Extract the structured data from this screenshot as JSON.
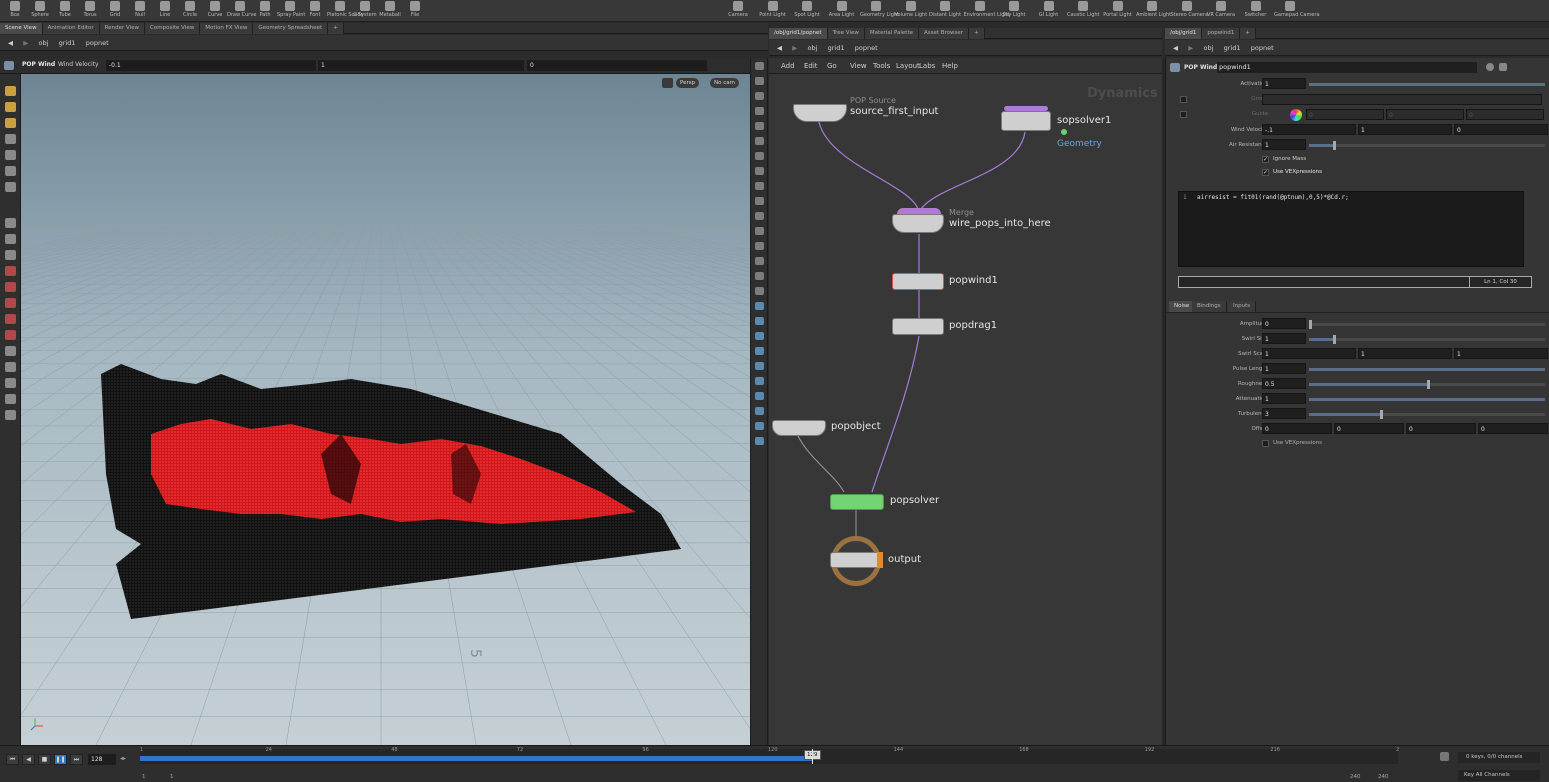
{
  "shelf": {
    "left_tools": [
      "Box",
      "Sphere",
      "Tube",
      "Torus",
      "Grid",
      "Null",
      "Line",
      "Circle",
      "Curve",
      "Draw Curve",
      "Path",
      "Spray Paint",
      "Font",
      "Platonic Solids",
      "L-System",
      "Metaball",
      "File"
    ],
    "right_tools": [
      "Camera",
      "Point Light",
      "Spot Light",
      "Area Light",
      "Geometry Light",
      "Volume Light",
      "Distant Light",
      "Environment Light",
      "Sky Light",
      "GI Light",
      "Caustic Light",
      "Portal Light",
      "Ambient Light",
      "Stereo Camera",
      "VR Camera",
      "Switcher",
      "Gamepad Camera"
    ]
  },
  "left_pane": {
    "tabs": [
      "Scene View",
      "Animation Editor",
      "Render View",
      "Composite View",
      "Motion FX View",
      "Geometry Spreadsheet"
    ],
    "path": [
      "obj",
      "grid1",
      "popnet"
    ],
    "op_bar": {
      "node_type": "POP Wind",
      "param_label": "Wind Velocity",
      "values": [
        "-0.1",
        "1",
        "0"
      ]
    },
    "viewport": {
      "camera_mode": "Persp",
      "camera": "No cam",
      "grid_number": "5"
    }
  },
  "network_pane": {
    "tabs": [
      "/obj/grid1/popnet",
      "Tree View",
      "Material Palette",
      "Asset Browser"
    ],
    "path": [
      "obj",
      "grid1",
      "popnet"
    ],
    "menu": [
      "Add",
      "Edit",
      "Go",
      "View",
      "Tools",
      "Layout",
      "Labs",
      "Help"
    ],
    "context_label": "Dynamics",
    "nodes": {
      "source": {
        "type": "POP Source",
        "name": "source_first_input"
      },
      "sopsolver": {
        "name": "sopsolver1",
        "sub": "Geometry"
      },
      "merge": {
        "type": "Merge",
        "name": "wire_pops_into_here"
      },
      "popwind": {
        "name": "popwind1"
      },
      "popdrag": {
        "name": "popdrag1"
      },
      "popobject": {
        "name": "popobject"
      },
      "popsolver": {
        "name": "popsolver"
      },
      "output": {
        "name": "output"
      }
    }
  },
  "param_pane": {
    "tabs": [
      "/obj/grid1",
      "popwind1"
    ],
    "path": [
      "obj",
      "grid1",
      "popnet"
    ],
    "header": {
      "node_type": "POP Wind",
      "node_name": "popwind1"
    },
    "rows": {
      "activation": {
        "label": "Activation",
        "value": "1"
      },
      "group": {
        "label": "Group"
      },
      "guide": {
        "label": "Guide",
        "values": [
          "0",
          "0",
          "0"
        ]
      },
      "wind_velocity": {
        "label": "Wind Velocity",
        "values": [
          "-.1",
          "1",
          "0"
        ]
      },
      "air_resistance": {
        "label": "Air Resistance",
        "value": "1"
      },
      "ignore_mass": "Ignore Mass",
      "use_vex": "Use VEXpressions"
    },
    "code": {
      "line_no": "1",
      "text": "airresist = fit01(rand(@ptnum),0,5)*@Cd.r;",
      "status": "Ln 1, Col 30"
    },
    "sub_tabs": [
      "Noise",
      "Bindings",
      "Inputs"
    ],
    "noise": {
      "amplitude": {
        "label": "Amplitude",
        "value": "0",
        "level": 0
      },
      "swirl_size": {
        "label": "Swirl Size",
        "value": "1",
        "level": 0.1
      },
      "swirl_scale": {
        "label": "Swirl Scale",
        "values": [
          "1",
          "1",
          "1"
        ]
      },
      "pulse_length": {
        "label": "Pulse Length",
        "value": "1",
        "level": 1
      },
      "roughness": {
        "label": "Roughness",
        "value": "0.5",
        "level": 0.5
      },
      "attenuation": {
        "label": "Attenuation",
        "value": "1",
        "level": 1
      },
      "turbulence": {
        "label": "Turbulence",
        "value": "3",
        "level": 0.3
      },
      "offset": {
        "label": "Offset",
        "values": [
          "0",
          "0",
          "0",
          "0"
        ]
      },
      "use_vex": "Use VEXpressions"
    }
  },
  "timeline": {
    "current_frame": "128",
    "frame_marker": "129",
    "ticks": [
      "1",
      "24",
      "48",
      "72",
      "96",
      "120",
      "144",
      "168",
      "192",
      "216",
      "2"
    ],
    "range_start": "1",
    "range_start2": "1",
    "range_end": "240",
    "range_end2": "240",
    "keys_status": "0 keys, 0/0 channels",
    "key_all": "Key All Channels"
  },
  "colors": {
    "accent_blue": "#2f76c8",
    "solver_green": "#6bd36b",
    "merge_purple": "#b07ad8",
    "particle_red": "#ff2a2a"
  }
}
